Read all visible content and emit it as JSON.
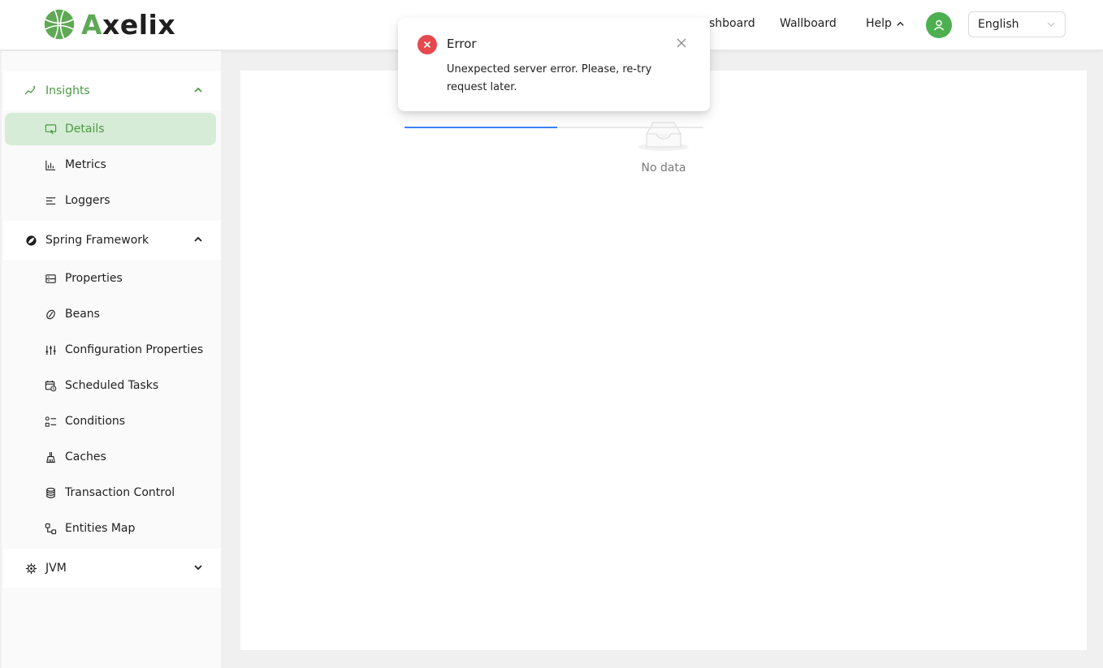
{
  "brand": {
    "name_accent": "A",
    "name_rest": "xelix",
    "accent_color": "#5fa855"
  },
  "header": {
    "nav": [
      {
        "label": "shboard"
      },
      {
        "label": "Wallboard"
      },
      {
        "label": "Help"
      }
    ],
    "language": {
      "selected": "English"
    }
  },
  "sidebar": {
    "sections": [
      {
        "label": "Insights",
        "expanded": true,
        "items": [
          {
            "label": "Details",
            "active": true
          },
          {
            "label": "Metrics"
          },
          {
            "label": "Loggers"
          }
        ]
      },
      {
        "label": "Spring Framework",
        "expanded": true,
        "items": [
          {
            "label": "Properties"
          },
          {
            "label": "Beans"
          },
          {
            "label": "Configuration Properties"
          },
          {
            "label": "Scheduled Tasks"
          },
          {
            "label": "Conditions"
          },
          {
            "label": "Caches"
          },
          {
            "label": "Transaction Control"
          },
          {
            "label": "Entities Map"
          }
        ]
      },
      {
        "label": "JVM",
        "expanded": false,
        "items": []
      }
    ]
  },
  "content": {
    "empty_text": "No data"
  },
  "notification": {
    "title": "Error",
    "message": "Unexpected server error. Please, re-try request later.",
    "progress_fraction": 0.51,
    "error_color": "#e5484d",
    "progress_color": "#3b82f6"
  }
}
